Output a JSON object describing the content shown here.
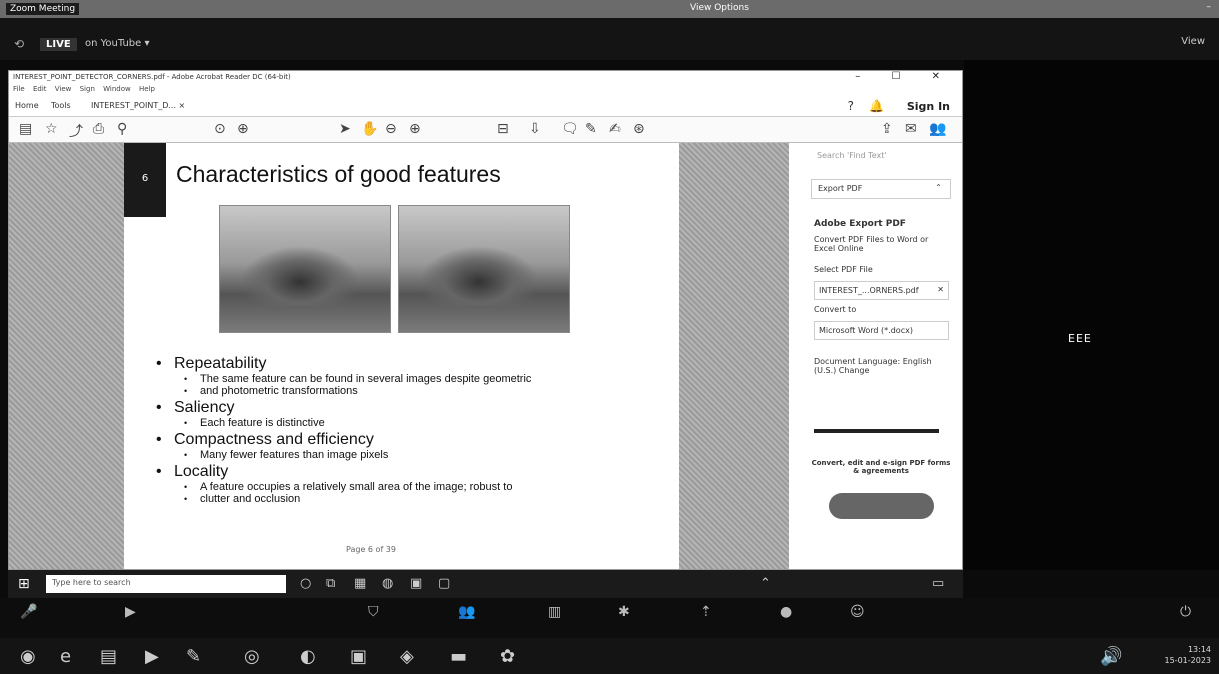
{
  "meeting": {
    "window_title": "Zoom Meeting",
    "view_options": "View Options",
    "live_label": "LIVE",
    "live_destination": "on YouTube ▾",
    "view_button": "View",
    "participant_name": "EEE"
  },
  "acrobat": {
    "title": "INTEREST_POINT_DETECTOR_CORNERS.pdf - Adobe Acrobat Reader DC (64-bit)",
    "window_controls": "– ☐ ✕",
    "menu": [
      "File",
      "Edit",
      "View",
      "Sign",
      "Window",
      "Help"
    ],
    "tabs": {
      "home": "Home",
      "tools": "Tools",
      "document": "INTEREST_POINT_D... ×"
    },
    "sign_in": "Sign In"
  },
  "slide": {
    "number": "6",
    "title": "Characteristics of good features",
    "bullets": [
      {
        "heading": "Repeatability",
        "sub": [
          "The same feature can be found in several images despite geometric",
          "and photometric transformations"
        ]
      },
      {
        "heading": "Saliency",
        "sub": [
          "Each feature is distinctive"
        ]
      },
      {
        "heading": "Compactness and efficiency",
        "sub": [
          "Many fewer features than image pixels"
        ]
      },
      {
        "heading": "Locality",
        "sub": [
          "A feature occupies a relatively small area of the image; robust to",
          "clutter and occlusion"
        ]
      }
    ],
    "page_note": "Page 6 of 39"
  },
  "right_pane": {
    "search_placeholder": "Search 'Find Text'",
    "export_label": "Export PDF",
    "heading": "Adobe Export PDF",
    "description": "Convert PDF Files to Word or Excel Online",
    "select_label": "Select PDF File",
    "file_name": "INTEREST_...ORNERS.pdf",
    "convert_label": "Convert to",
    "format": "Microsoft Word (*.docx)",
    "language": "Document Language: English (U.S.) Change",
    "promo": "Convert, edit and e-sign PDF forms & agreements",
    "trial_button": ""
  },
  "taskbar_inner": {
    "search_placeholder": "Type here to search"
  },
  "clock": {
    "time": "13:14",
    "date": "15-01-2023"
  }
}
